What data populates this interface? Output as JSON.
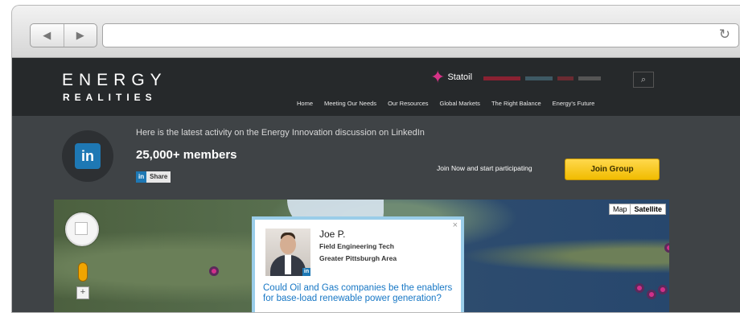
{
  "browser": {
    "back_label": "◀",
    "forward_label": "▶",
    "reload_label": "↻"
  },
  "site": {
    "logo_top": "ENERGY",
    "logo_bottom": "REALITIES",
    "brand_name": "Statoil",
    "menu": [
      "Home",
      "Meeting Our Needs",
      "Our Resources",
      "Global Markets",
      "The Right Balance",
      "Energy's Future"
    ]
  },
  "linkedin": {
    "logo": "in",
    "activity_text": "Here is the latest activity on the Energy Innovation discussion on LinkedIn",
    "members": "25,000+ members",
    "share_in": "in",
    "share_label": "Share",
    "join_text": "Join Now and start participating",
    "join_button": "Join Group"
  },
  "map": {
    "toggle": [
      "Map",
      "Satellite"
    ],
    "zoom_label": "+",
    "popup": {
      "name": "Joe P.",
      "role": "Field Engineering Tech",
      "location": "Greater Pittsburgh Area",
      "question": "Could Oil and Gas companies be the enablers for base-load renewable power generation?",
      "close": "×"
    }
  },
  "icons": [
    "search-icon",
    "close-icon",
    "linkedin-icon",
    "pan-control-icon",
    "pegman-icon",
    "map-marker-icon"
  ],
  "colors": {
    "accent": "#f6c21a",
    "linkedin": "#1e78b4",
    "link": "#1777c5",
    "marker": "#d12f8a"
  }
}
